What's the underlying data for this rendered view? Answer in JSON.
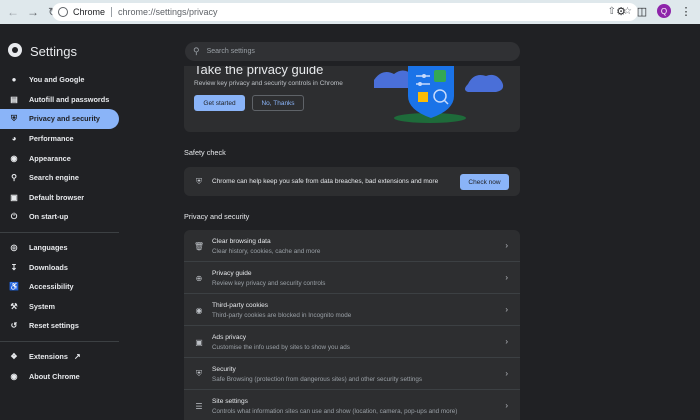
{
  "browser": {
    "omnibox_chip": "Chrome",
    "url": "chrome://settings/privacy",
    "profile_initial": "Q"
  },
  "header": {
    "title": "Settings",
    "search_placeholder": "Search settings"
  },
  "sidebar": {
    "items": [
      {
        "label": "You and Google",
        "icon": "person-icon"
      },
      {
        "label": "Autofill and passwords",
        "icon": "clipboard-icon"
      },
      {
        "label": "Privacy and security",
        "icon": "shield-icon"
      },
      {
        "label": "Performance",
        "icon": "speedometer-icon"
      },
      {
        "label": "Appearance",
        "icon": "palette-icon"
      },
      {
        "label": "Search engine",
        "icon": "search-icon"
      },
      {
        "label": "Default browser",
        "icon": "browser-icon"
      },
      {
        "label": "On start-up",
        "icon": "power-icon"
      },
      {
        "label": "Languages",
        "icon": "globe-icon"
      },
      {
        "label": "Downloads",
        "icon": "download-icon"
      },
      {
        "label": "Accessibility",
        "icon": "accessibility-icon"
      },
      {
        "label": "System",
        "icon": "wrench-icon"
      },
      {
        "label": "Reset settings",
        "icon": "history-icon"
      },
      {
        "label": "Extensions",
        "icon": "puzzle-icon"
      },
      {
        "label": "About Chrome",
        "icon": "chrome-icon"
      }
    ]
  },
  "guide": {
    "title": "Take the privacy guide",
    "description": "Review key privacy and security controls in Chrome",
    "primary_label": "Get started",
    "secondary_label": "No, Thanks"
  },
  "safety": {
    "section_title": "Safety check",
    "text": "Chrome can help keep you safe from data breaches, bad extensions and more",
    "button_label": "Check now"
  },
  "privacy": {
    "section_title": "Privacy and security",
    "rows": [
      {
        "title": "Clear browsing data",
        "subtitle": "Clear history, cookies, cache and more",
        "icon": "trash-icon"
      },
      {
        "title": "Privacy guide",
        "subtitle": "Review key privacy and security controls",
        "icon": "compass-icon"
      },
      {
        "title": "Third-party cookies",
        "subtitle": "Third-party cookies are blocked in Incognito mode",
        "icon": "cookie-icon"
      },
      {
        "title": "Ads privacy",
        "subtitle": "Customise the info used by sites to show you ads",
        "icon": "ads-icon"
      },
      {
        "title": "Security",
        "subtitle": "Safe Browsing (protection from dangerous sites) and other security settings",
        "icon": "shield-icon"
      },
      {
        "title": "Site settings",
        "subtitle": "Controls what information sites can use and show (location, camera, pop-ups and more)",
        "icon": "sliders-icon"
      }
    ]
  },
  "colors": {
    "accent": "#8ab4f8",
    "background": "#202124",
    "card": "#2d2e30"
  }
}
